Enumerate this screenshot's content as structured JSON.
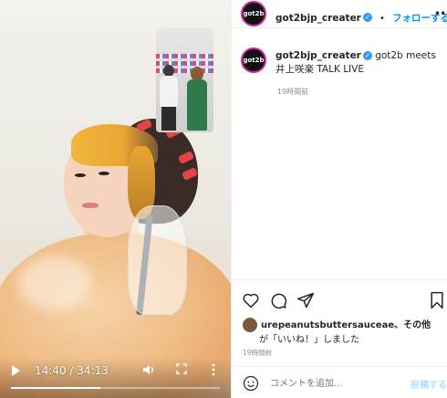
{
  "video": {
    "current_time": "14:40",
    "separator": " / ",
    "duration": "34:13",
    "progress_fraction": 0.43
  },
  "header": {
    "username": "got2bjp_creater",
    "verified": true,
    "separator": "•",
    "follow_label": "フォローする",
    "more_label": "•••",
    "avatar_text": "got2b"
  },
  "caption": {
    "username": "got2bjp_creater",
    "text": "got2b meets 井上咲楽 TALK LIVE",
    "time_ago": "19時間前"
  },
  "likes": {
    "user": "urepeanutsbuttersauceae",
    "suffix": "、その他",
    "line2": "が「いいね！」しました"
  },
  "post_time": "19時間前",
  "comment": {
    "placeholder": "コメントを追加...",
    "post_label": "投稿する"
  },
  "icons": {
    "like": "heart-icon",
    "comment": "comment-icon",
    "share": "share-icon",
    "save": "bookmark-icon",
    "emoji": "emoji-icon"
  },
  "colors": {
    "follow": "#0095f6",
    "verified": "#3897f0",
    "post_disabled": "#b2dffc"
  }
}
